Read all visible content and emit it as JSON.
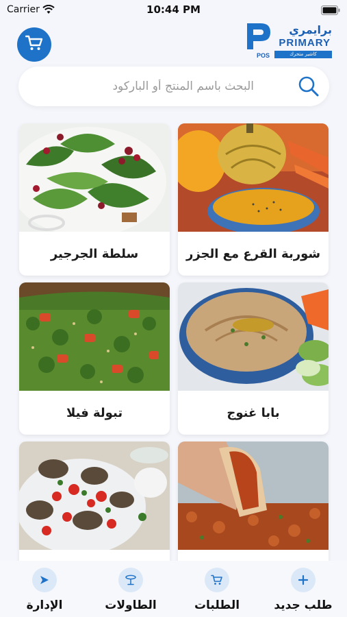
{
  "status_bar": {
    "carrier": "Carrier",
    "time": "10:44 PM"
  },
  "header": {
    "cart_icon": "shopping-cart-icon",
    "logo": {
      "arabic": "برايمري",
      "english": "PRIMARY",
      "tagline": "كاشير متحرك",
      "pos": "POS"
    }
  },
  "search": {
    "placeholder": "البحث باسم المنتج أو الباركود",
    "value": ""
  },
  "products": [
    {
      "name": "شوربة القرع مع الجزر",
      "image": "pumpkin-soup"
    },
    {
      "name": "سلطة الجرجير",
      "image": "arugula-salad"
    },
    {
      "name": "بابا غنوج",
      "image": "baba-ghanoush"
    },
    {
      "name": "تبولة فيلا",
      "image": "tabbouleh"
    },
    {
      "name": "",
      "image": "bulgur-wrap"
    },
    {
      "name": "",
      "image": "grilled-eggplant"
    }
  ],
  "tabs": [
    {
      "label": "طلب جديد",
      "icon": "plus-icon"
    },
    {
      "label": "الطلبات",
      "icon": "cart-icon"
    },
    {
      "label": "الطاولات",
      "icon": "table-icon"
    },
    {
      "label": "الإدارة",
      "icon": "send-icon"
    }
  ],
  "colors": {
    "primary": "#1e73c8",
    "background": "#f4f6fb",
    "tab_icon_bg": "#dbe8f8"
  }
}
